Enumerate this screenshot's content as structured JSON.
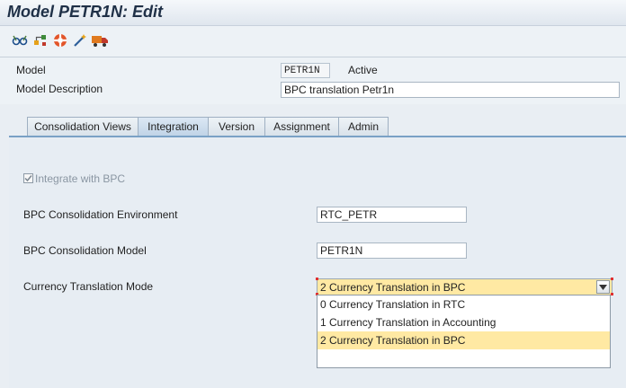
{
  "window": {
    "title": "Model PETR1N: Edit"
  },
  "toolbar": {
    "icons": [
      "glasses-icon",
      "hierarchy-icon",
      "lifebuoy-icon",
      "magic-wand-icon",
      "transport-truck-icon"
    ]
  },
  "header": {
    "model_label": "Model",
    "model_value": "PETR1N",
    "model_status": "Active",
    "description_label": "Model Description",
    "description_value": "BPC translation Petr1n"
  },
  "tabs": [
    {
      "label": "Consolidation Views"
    },
    {
      "label": "Integration"
    },
    {
      "label": "Version"
    },
    {
      "label": "Assignment"
    },
    {
      "label": "Admin"
    }
  ],
  "integration": {
    "integrate_label": "Integrate with BPC",
    "environment_label": "BPC Consolidation Environment",
    "environment_value": "RTC_PETR",
    "bpc_model_label": "BPC Consolidation Model",
    "bpc_model_value": "PETR1N",
    "currency_mode_label": "Currency Translation Mode",
    "currency_mode_selected": "2 Currency Translation in BPC",
    "currency_mode_options": [
      "0 Currency Translation in RTC",
      "1 Currency Translation in Accounting",
      "2 Currency Translation in BPC"
    ]
  },
  "colors": {
    "highlight": "#ffe9a3",
    "tab_active": "#bfd3e6",
    "title": "#1f3047"
  }
}
